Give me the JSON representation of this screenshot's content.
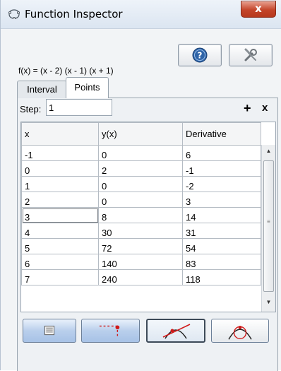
{
  "window": {
    "title": "Function Inspector",
    "close_glyph": "x"
  },
  "function": {
    "expression": "f(x) = (x - 2) (x - 1) (x + 1)"
  },
  "toolbar": {
    "help_icon": "help-icon",
    "settings_icon": "tools-icon"
  },
  "tabs": [
    {
      "label": "Interval"
    },
    {
      "label": "Points"
    }
  ],
  "step": {
    "label": "Step:",
    "value": "1"
  },
  "actions": {
    "add_glyph": "+",
    "remove_glyph": "x"
  },
  "table": {
    "headers": [
      "x",
      "y(x)",
      "Derivative"
    ],
    "rows": [
      [
        "-1",
        "0",
        "6"
      ],
      [
        "0",
        "2",
        "-1"
      ],
      [
        "1",
        "0",
        "-2"
      ],
      [
        "2",
        "0",
        "3"
      ],
      [
        "3",
        "8",
        "14"
      ],
      [
        "4",
        "30",
        "31"
      ],
      [
        "5",
        "72",
        "54"
      ],
      [
        "6",
        "140",
        "83"
      ],
      [
        "7",
        "240",
        "118"
      ]
    ]
  },
  "bottom_buttons": [
    {
      "icon": "table-icon"
    },
    {
      "icon": "point-lines-icon"
    },
    {
      "icon": "tangent-icon"
    },
    {
      "icon": "osculating-circle-icon"
    }
  ]
}
